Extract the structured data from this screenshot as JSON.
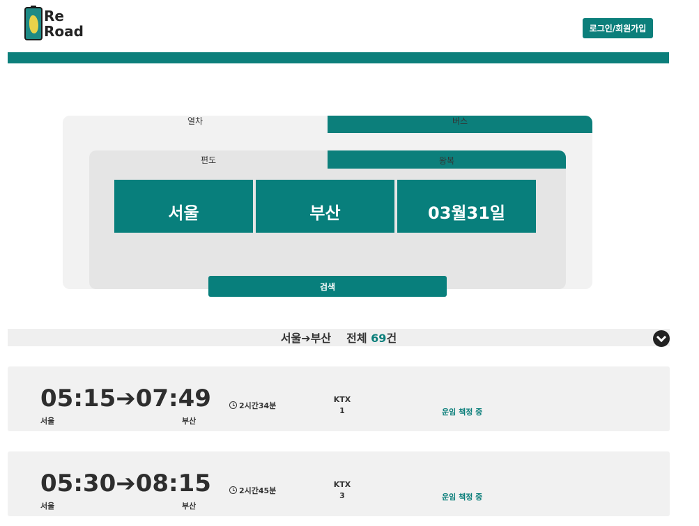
{
  "logo": {
    "line1": "Re",
    "line2": "Road"
  },
  "header": {
    "login_label": "로그인/회원가입"
  },
  "transport_tabs": {
    "train": "열차",
    "bus": "버스"
  },
  "trip_tabs": {
    "oneway": "편도",
    "round": "왕복"
  },
  "search": {
    "from": "서울",
    "to": "부산",
    "date": "03월31일",
    "button": "검색"
  },
  "results": {
    "from": "서울",
    "to": "부산",
    "total_label": "전체",
    "count": "69",
    "unit": "건"
  },
  "trips": [
    {
      "time": "05:15➔07:49",
      "from": "서울",
      "to": "부산",
      "duration": "2시간34분",
      "type": "KTX",
      "number": "1",
      "status": "운임 책정 중"
    },
    {
      "time": "05:30➔08:15",
      "from": "서울",
      "to": "부산",
      "duration": "2시간45분",
      "type": "KTX",
      "number": "3",
      "status": "운임 책정 중"
    }
  ],
  "colors": {
    "accent": "#0c7f7b",
    "field": "#087f7c"
  }
}
